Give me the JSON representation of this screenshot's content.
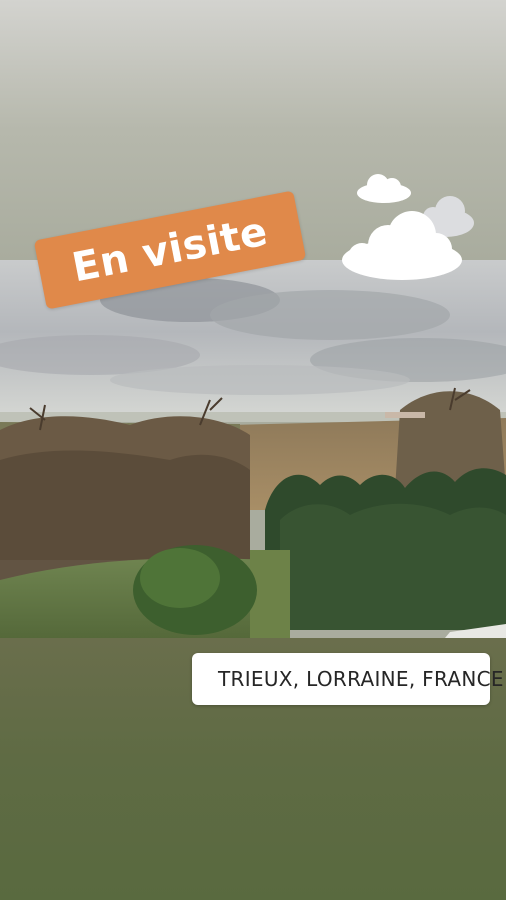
{
  "sticker": {
    "text": "En visite",
    "color": "#e0894a"
  },
  "location": {
    "text": "TRIEUX, LORRAINE, FRANCE",
    "icon": "location-pin-icon",
    "pin_color": "#56a8e8"
  },
  "clouds_sticker": {
    "icon": "clouds-icon"
  },
  "photo": {
    "subject": "countryside-landscape"
  }
}
